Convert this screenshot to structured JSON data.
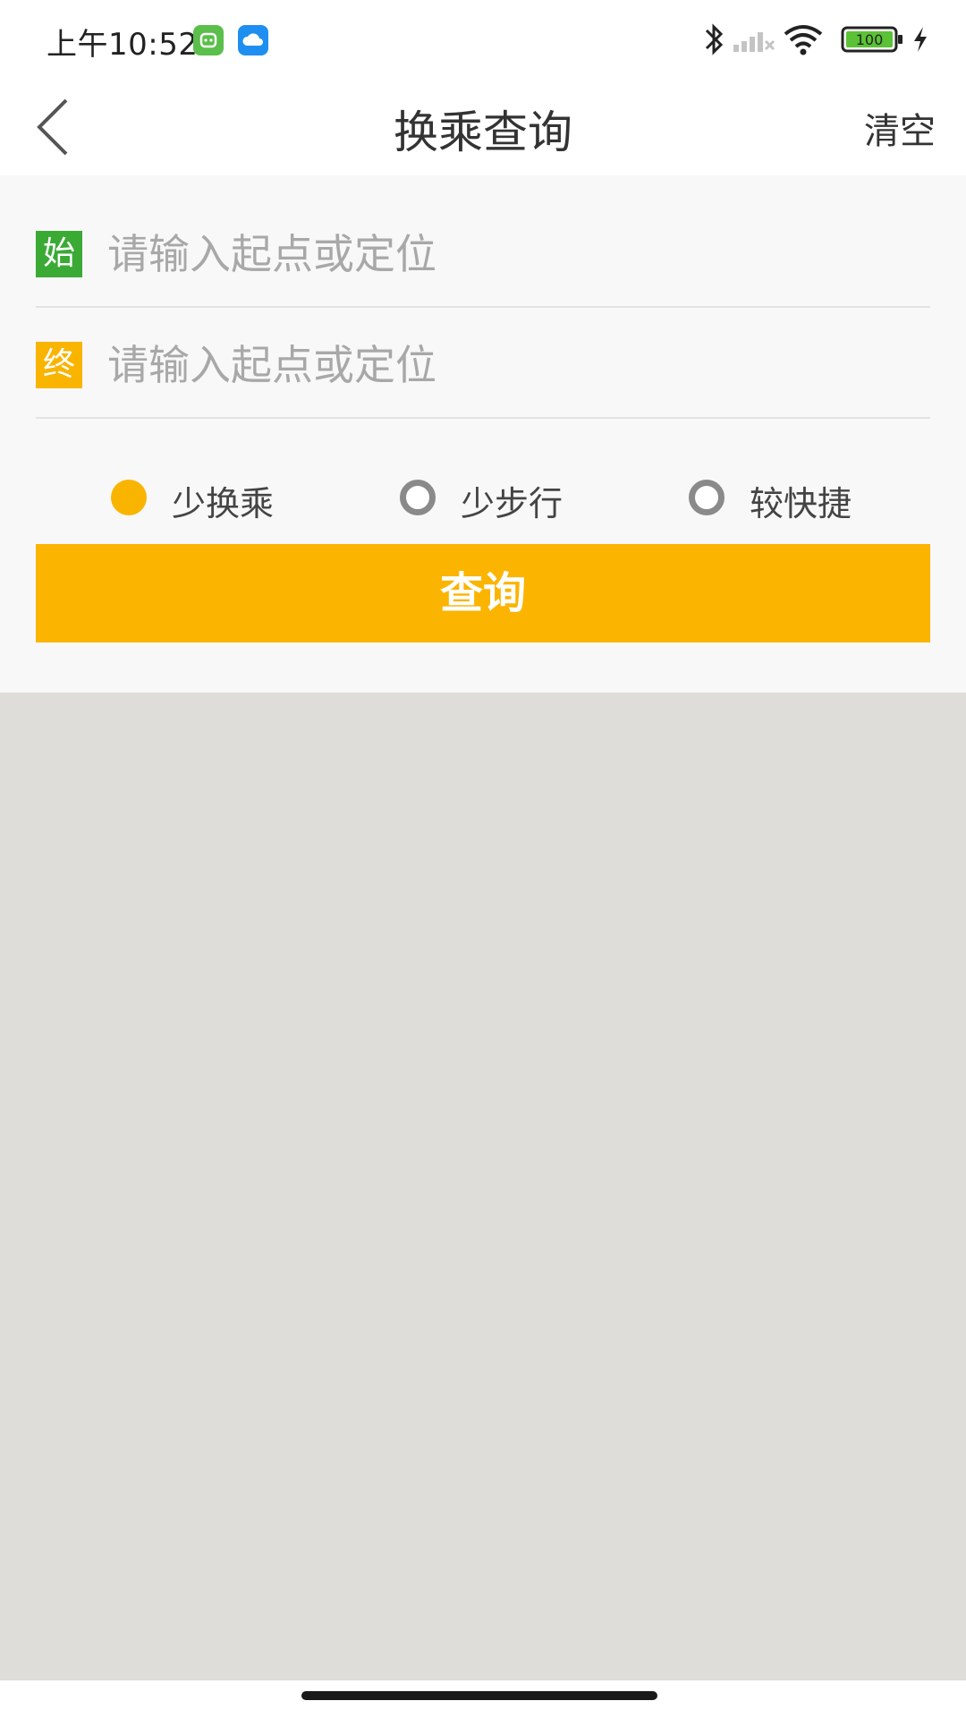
{
  "status_bar": {
    "time": "上午10:52",
    "battery": "100",
    "icons": [
      "app-green-icon",
      "cloud-app-icon",
      "bluetooth-icon",
      "signal-icon",
      "wifi-icon",
      "battery-icon",
      "charging-icon"
    ]
  },
  "nav": {
    "back_icon": "chevron-left-icon",
    "title": "换乘查询",
    "clear_label": "清空"
  },
  "form": {
    "start": {
      "tag": "始",
      "placeholder": "请输入起点或定位",
      "value": ""
    },
    "end": {
      "tag": "终",
      "placeholder": "请输入起点或定位",
      "value": ""
    },
    "options": [
      {
        "label": "少换乘",
        "selected": true
      },
      {
        "label": "少步行",
        "selected": false
      },
      {
        "label": "较快捷",
        "selected": false
      }
    ],
    "query_label": "查询"
  },
  "colors": {
    "accent": "#fbb400",
    "start_tag": "#3aaa35",
    "end_tag": "#f9b400",
    "result_bg": "#dfddd9"
  }
}
